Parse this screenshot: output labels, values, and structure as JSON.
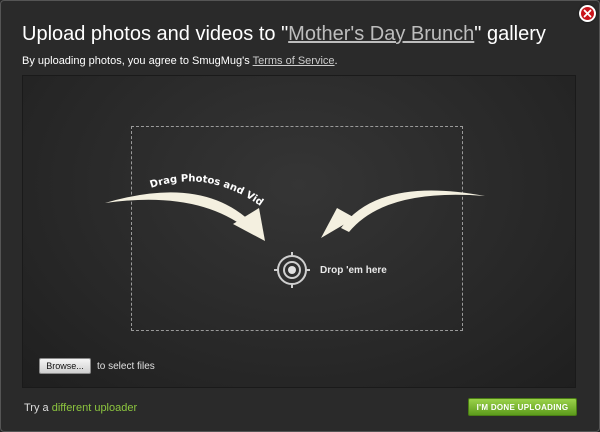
{
  "header": {
    "title_prefix": "Upload photos and videos to \"",
    "gallery_name": "Mother's Day Brunch",
    "title_suffix": "\" gallery",
    "terms_prefix": "By uploading photos, you agree to SmugMug's ",
    "terms_link": "Terms of Service",
    "terms_suffix": "."
  },
  "close_icon": "close-icon",
  "drop_area": {
    "drag_label": "Drag Photos and Videos",
    "drop_label": "Drop 'em here"
  },
  "browse": {
    "button_label": "Browse...",
    "hint": "to select files"
  },
  "footer": {
    "try_prefix": "Try a ",
    "alt_link": "different uploader",
    "done_label": "I'M DONE UPLOADING"
  },
  "colors": {
    "accent_green": "#8dc63f",
    "close_red": "#c8141b"
  }
}
